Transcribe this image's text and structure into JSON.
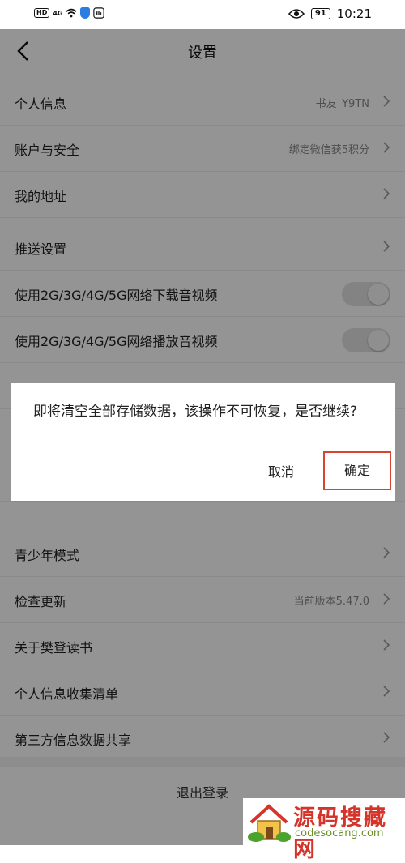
{
  "status_bar": {
    "hd": "HD",
    "signal": "4G",
    "battery": "91",
    "time": "10:21"
  },
  "header": {
    "title": "设置"
  },
  "settings": {
    "personal_info": {
      "label": "个人信息",
      "value": "书友_Y9TN"
    },
    "account_security": {
      "label": "账户与安全",
      "value": "绑定微信获5积分"
    },
    "my_address": {
      "label": "我的地址"
    },
    "push_settings": {
      "label": "推送设置"
    },
    "download_on_mobile": {
      "label": "使用2G/3G/4G/5G网络下载音视频",
      "enabled": false
    },
    "play_on_mobile": {
      "label": "使用2G/3G/4G/5G网络播放音视频",
      "enabled": false
    },
    "teen_mode": {
      "label": "青少年模式"
    },
    "check_update": {
      "label": "检查更新",
      "value": "当前版本5.47.0"
    },
    "about": {
      "label": "关于樊登读书"
    },
    "info_collection": {
      "label": "个人信息收集清单"
    },
    "third_party_sharing": {
      "label": "第三方信息数据共享"
    },
    "logout": {
      "label": "退出登录"
    }
  },
  "dialog": {
    "message": "即将清空全部存储数据，该操作不可恢复，是否继续?",
    "cancel_label": "取消",
    "confirm_label": "确定"
  },
  "watermark": {
    "text": "源码搜藏网",
    "url": "codesocang.com"
  },
  "colors": {
    "accent_red": "#d9442f",
    "overlay": "rgba(0,0,0,0.42)",
    "toggle_off": "#e2e2e2"
  }
}
